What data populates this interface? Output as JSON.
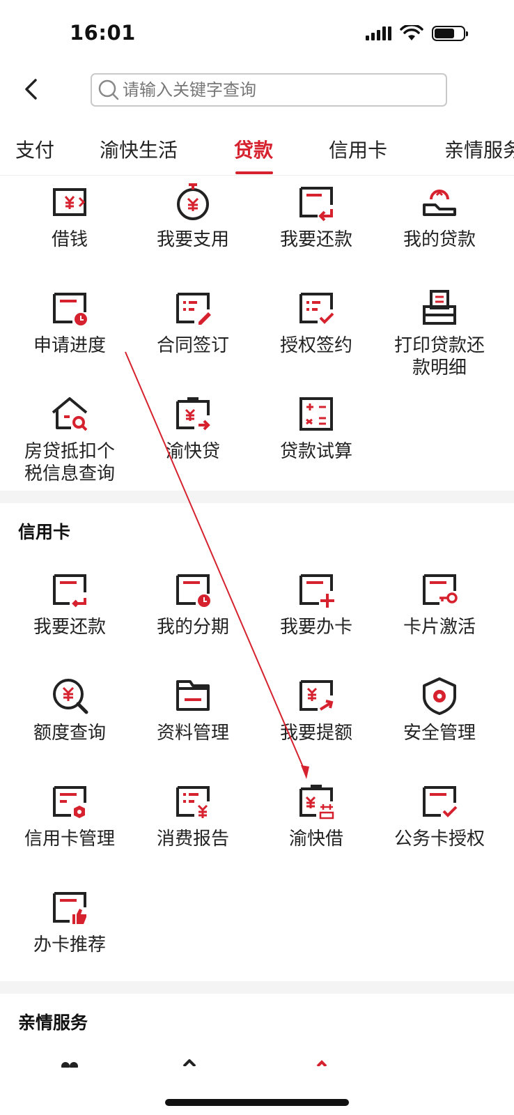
{
  "status_bar": {
    "time": "16:01"
  },
  "search": {
    "placeholder": "请输入关键字查询"
  },
  "tabs": [
    {
      "label": "支付"
    },
    {
      "label": "渝快生活"
    },
    {
      "label": "贷款"
    },
    {
      "label": "信用卡"
    },
    {
      "label": "亲情服务"
    }
  ],
  "loan": {
    "items": [
      {
        "label": "借钱",
        "icon": "yuan-transfer-icon"
      },
      {
        "label": "我要支用",
        "icon": "yuan-timer-icon"
      },
      {
        "label": "我要还款",
        "icon": "repay-arrow-icon"
      },
      {
        "label": "我的贷款",
        "icon": "loan-hand-icon"
      },
      {
        "label": "申请进度",
        "icon": "progress-clock-icon"
      },
      {
        "label": "合同签订",
        "icon": "contract-pen-icon"
      },
      {
        "label": "授权签约",
        "icon": "authorize-check-icon"
      },
      {
        "label": "打印贷款还\n款明细",
        "icon": "print-icon"
      },
      {
        "label": "房贷抵扣个\n税信息查询",
        "icon": "house-search-icon"
      },
      {
        "label": "渝快贷",
        "icon": "yuan-clipboard-icon"
      },
      {
        "label": "贷款试算",
        "icon": "calculator-icon"
      }
    ]
  },
  "credit_card": {
    "title": "信用卡",
    "items": [
      {
        "label": "我要还款",
        "icon": "card-repay-icon"
      },
      {
        "label": "我的分期",
        "icon": "installment-clock-icon"
      },
      {
        "label": "我要办卡",
        "icon": "card-add-icon"
      },
      {
        "label": "卡片激活",
        "icon": "card-key-icon"
      },
      {
        "label": "额度查询",
        "icon": "yuan-search-icon"
      },
      {
        "label": "资料管理",
        "icon": "folder-icon"
      },
      {
        "label": "我要提额",
        "icon": "raise-limit-icon"
      },
      {
        "label": "安全管理",
        "icon": "shield-icon"
      },
      {
        "label": "信用卡管理",
        "icon": "card-settings-icon"
      },
      {
        "label": "消费报告",
        "icon": "report-yuan-icon"
      },
      {
        "label": "渝快借",
        "icon": "borrow-clipboard-icon"
      },
      {
        "label": "公务卡授权",
        "icon": "card-check-icon"
      },
      {
        "label": "办卡推荐",
        "icon": "thumbs-up-card-icon"
      }
    ]
  },
  "family": {
    "title": "亲情服务"
  },
  "colors": {
    "accent": "#d6212e",
    "icon_dark": "#222222"
  }
}
